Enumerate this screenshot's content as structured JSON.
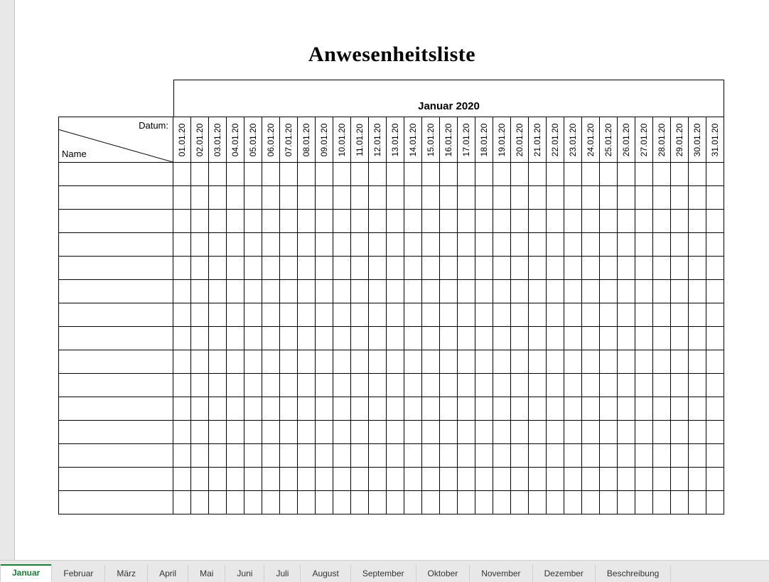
{
  "document": {
    "title": "Anwesenheitsliste",
    "month_label": "Januar 2020",
    "header": {
      "datum_label": "Datum:",
      "name_label": "Name"
    },
    "dates": [
      "01.01.20",
      "02.01.20",
      "03.01.20",
      "04.01.20",
      "05.01.20",
      "06.01.20",
      "07.01.20",
      "08.01.20",
      "09.01.20",
      "10.01.20",
      "11.01.20",
      "12.01.20",
      "13.01.20",
      "14.01.20",
      "15.01.20",
      "16.01.20",
      "17.01.20",
      "18.01.20",
      "19.01.20",
      "20.01.20",
      "21.01.20",
      "22.01.20",
      "23.01.20",
      "24.01.20",
      "25.01.20",
      "26.01.20",
      "27.01.20",
      "28.01.20",
      "29.01.20",
      "30.01.20",
      "31.01.20"
    ],
    "names": [
      "",
      "",
      "",
      "",
      "",
      "",
      "",
      "",
      "",
      "",
      "",
      "",
      "",
      "",
      ""
    ]
  },
  "tabs": {
    "items": [
      "Januar",
      "Februar",
      "März",
      "April",
      "Mai",
      "Juni",
      "Juli",
      "August",
      "September",
      "Oktober",
      "November",
      "Dezember",
      "Beschreibung"
    ],
    "active_index": 0
  }
}
